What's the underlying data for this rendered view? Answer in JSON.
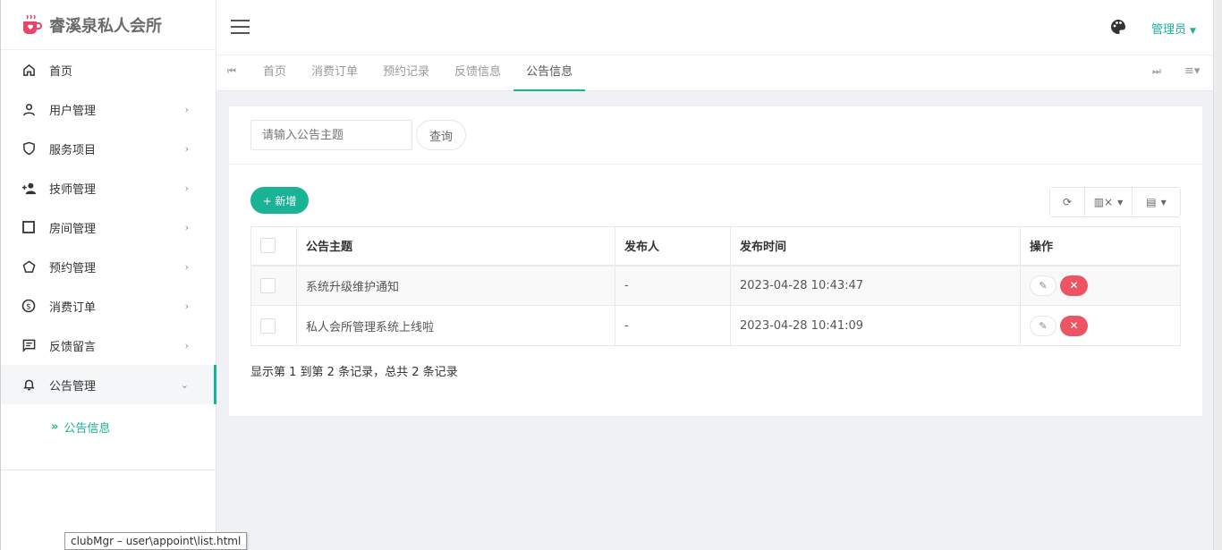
{
  "app": {
    "logo_text": "睿溪泉私人会所",
    "accent_color": "#1ab394",
    "danger_color": "#ed5565"
  },
  "sidebar": {
    "items": [
      {
        "label": "首页",
        "icon": "home-icon",
        "has_children": false
      },
      {
        "label": "用户管理",
        "icon": "user-icon",
        "has_children": true
      },
      {
        "label": "服务项目",
        "icon": "shield-icon",
        "has_children": true
      },
      {
        "label": "技师管理",
        "icon": "user-plus-icon",
        "has_children": true
      },
      {
        "label": "房间管理",
        "icon": "square-icon",
        "has_children": true
      },
      {
        "label": "预约管理",
        "icon": "pentagon-icon",
        "has_children": true
      },
      {
        "label": "消费订单",
        "icon": "coin-icon",
        "has_children": true
      },
      {
        "label": "反馈留言",
        "icon": "message-icon",
        "has_children": true
      },
      {
        "label": "公告管理",
        "icon": "bell-icon",
        "has_children": true,
        "expanded": true
      }
    ],
    "submenu": [
      {
        "label": "公告信息",
        "active": true
      }
    ]
  },
  "topbar": {
    "admin_label": "管理员"
  },
  "tabs": {
    "items": [
      "首页",
      "消费订单",
      "预约记录",
      "反馈信息",
      "公告信息"
    ],
    "active_index": 4
  },
  "search": {
    "placeholder": "请输入公告主题",
    "button_label": "查询"
  },
  "toolbar": {
    "add_label": "+ 新增"
  },
  "table": {
    "columns": [
      "公告主题",
      "发布人",
      "发布时间",
      "操作"
    ],
    "rows": [
      {
        "title": "系统升级维护通知",
        "publisher": "-",
        "time": "2023-04-28 10:43:47"
      },
      {
        "title": "私人会所管理系统上线啦",
        "publisher": "-",
        "time": "2023-04-28 10:41:09"
      }
    ]
  },
  "pagination": {
    "info": "显示第 1 到第 2 条记录，总共 2 条记录"
  },
  "status_tooltip": "clubMgr – user\\appoint\\list.html"
}
